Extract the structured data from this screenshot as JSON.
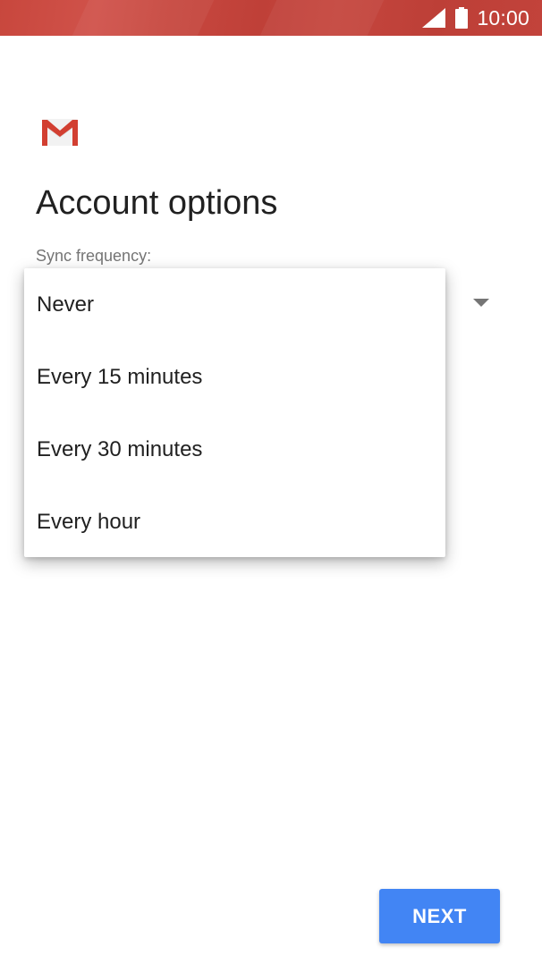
{
  "status_bar": {
    "time": "10:00",
    "signal_icon": "cellular-signal-icon",
    "battery_icon": "battery-icon",
    "color": "#c5463e"
  },
  "app": {
    "logo_icon": "gmail-logo-icon"
  },
  "page": {
    "title": "Account options",
    "sync_label": "Sync frequency:"
  },
  "sync_dropdown": {
    "arrow_icon": "dropdown-arrow-icon",
    "options": [
      "Never",
      "Every 15 minutes",
      "Every 30 minutes",
      "Every hour"
    ]
  },
  "footer": {
    "next_label": "NEXT",
    "accent": "#4285f4"
  }
}
